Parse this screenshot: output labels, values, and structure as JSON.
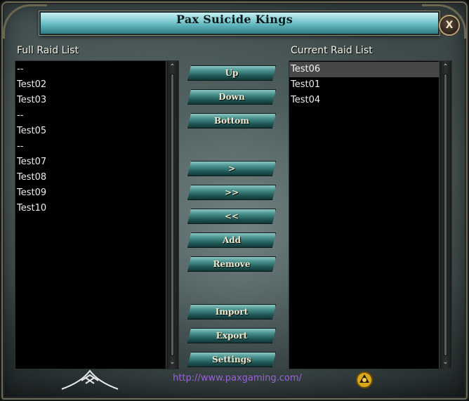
{
  "window": {
    "title": "Pax Suicide Kings",
    "close_label": "X"
  },
  "full_list": {
    "label": "Full Raid List",
    "items": [
      "--",
      "Test02",
      "Test03",
      "--",
      "Test05",
      "--",
      "Test07",
      "Test08",
      "Test09",
      "Test10"
    ]
  },
  "current_list": {
    "label": "Current Raid List",
    "items": [
      "Test06",
      "Test01",
      "Test04"
    ],
    "selected": "Test06"
  },
  "buttons": {
    "up": "Up",
    "down": "Down",
    "bottom": "Bottom",
    "move_right": ">",
    "move_all_right": ">>",
    "move_all_left": "<<",
    "add": "Add",
    "remove": "Remove",
    "import": "Import",
    "export": "Export",
    "settings": "Settings"
  },
  "footer": {
    "url": "http://www.paxgaming.com/"
  },
  "colors": {
    "accent_teal": "#4d9592",
    "url_purple": "#9b62d8",
    "list_bg": "#000000"
  },
  "icons": [
    "close-icon",
    "scroll-up-icon",
    "scroll-down-icon",
    "pax-logo-icon",
    "gold-emblem-icon"
  ]
}
